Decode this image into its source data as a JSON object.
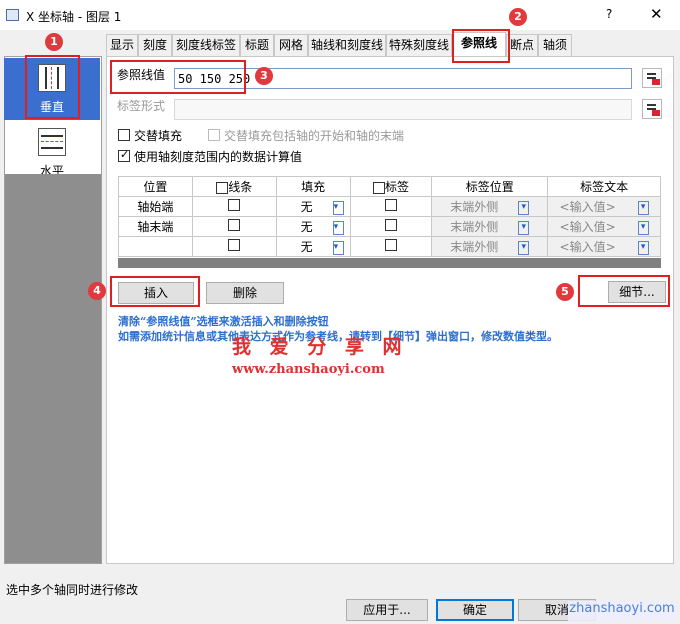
{
  "window": {
    "title": "X 坐标轴 - 图层 1",
    "help": "?",
    "close": "✕"
  },
  "sidebar": {
    "items": [
      {
        "label": "垂直",
        "selected": true
      },
      {
        "label": "水平",
        "selected": false
      }
    ]
  },
  "tabs": [
    "显示",
    "刻度",
    "刻度线标签",
    "标题",
    "网格",
    "轴线和刻度线",
    "特殊刻度线",
    "参照线",
    "断点",
    "轴须"
  ],
  "ref": {
    "label": "参照线值",
    "value": "50 150 250",
    "tag_label": "标签形式",
    "tag_value": ""
  },
  "options": {
    "fill": "交替填充",
    "fill_ends": "交替填充包括轴的开始和轴的末端",
    "use_range": "使用轴刻度范围内的数据计算值",
    "use_range_checked": true
  },
  "table": {
    "headers": {
      "pos": "位置",
      "line": "线条",
      "fill": "填充",
      "label": "标签",
      "label_pos": "标签位置",
      "label_text": "标签文本"
    },
    "rows": [
      {
        "pos": "轴始端",
        "fill": "无",
        "label_pos": "末端外侧",
        "label_text": "<输入值>"
      },
      {
        "pos": "轴末端",
        "fill": "无",
        "label_pos": "末端外侧",
        "label_text": "<输入值>"
      },
      {
        "pos": "",
        "fill": "无",
        "label_pos": "末端外侧",
        "label_text": "<输入值>"
      }
    ]
  },
  "buttons": {
    "insert": "插入",
    "delete": "删除",
    "detail": "细节...",
    "apply": "应用于...",
    "ok": "确定",
    "cancel": "取消"
  },
  "note": {
    "line1": "清除“参照线值”选框来激活插入和删除按钮",
    "line2": "如需添加统计信息或其他表达方式作为参考线，请转到【细节】弹出窗口，修改数值类型。"
  },
  "watermark": {
    "title": "我 爱 分 享 网",
    "url": "www.zhanshaoyi.com",
    "corner": "zhanshaoyi.com"
  },
  "status": "选中多个轴同时进行修改",
  "badges": [
    "1",
    "2",
    "3",
    "4",
    "5"
  ]
}
